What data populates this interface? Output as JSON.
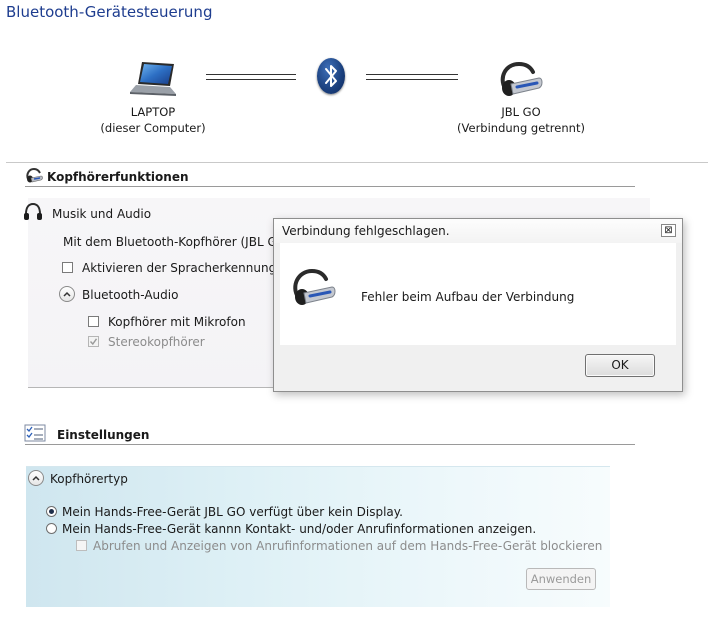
{
  "window": {
    "title": "Bluetooth-Gerätesteuerung"
  },
  "devices": {
    "local": {
      "name": "LAPTOP",
      "subtitle": "(dieser Computer)",
      "icon": "laptop-icon"
    },
    "remote": {
      "name": "JBL GO",
      "subtitle": "(Verbindung getrennt)",
      "icon": "headset-icon"
    },
    "link_icon": "bluetooth-icon"
  },
  "headphone_section": {
    "title": "Kopfhörerfunktionen",
    "musik": {
      "title": "Musik und Audio",
      "description": "Mit dem Bluetooth-Kopfhörer (JBL GO) v",
      "speech_recognition_label": "Aktivieren der Spracherkennung für",
      "bt_audio_label": "Bluetooth-Audio",
      "headset_mic_label": "Kopfhörer mit Mikrofon",
      "stereo_label": "Stereokopfhörer"
    }
  },
  "settings_section": {
    "title": "Einstellungen",
    "headset_type": {
      "title": "Kopfhörertyp",
      "option_no_display": "Mein Hands-Free-Gerät JBL GO verfügt über kein Display.",
      "option_display": "Mein Hands-Free-Gerät kannn Kontakt- und/oder Anrufinformationen anzeigen.",
      "block_calls_label": "Abrufen und Anzeigen von Anrufinformationen auf dem Hands-Free-Gerät blockieren",
      "apply_label": "Anwenden"
    }
  },
  "dialog": {
    "title": "Verbindung fehlgeschlagen.",
    "message": "Fehler beim Aufbau der Verbindung",
    "ok_label": "OK",
    "close_glyph": "⊠"
  }
}
